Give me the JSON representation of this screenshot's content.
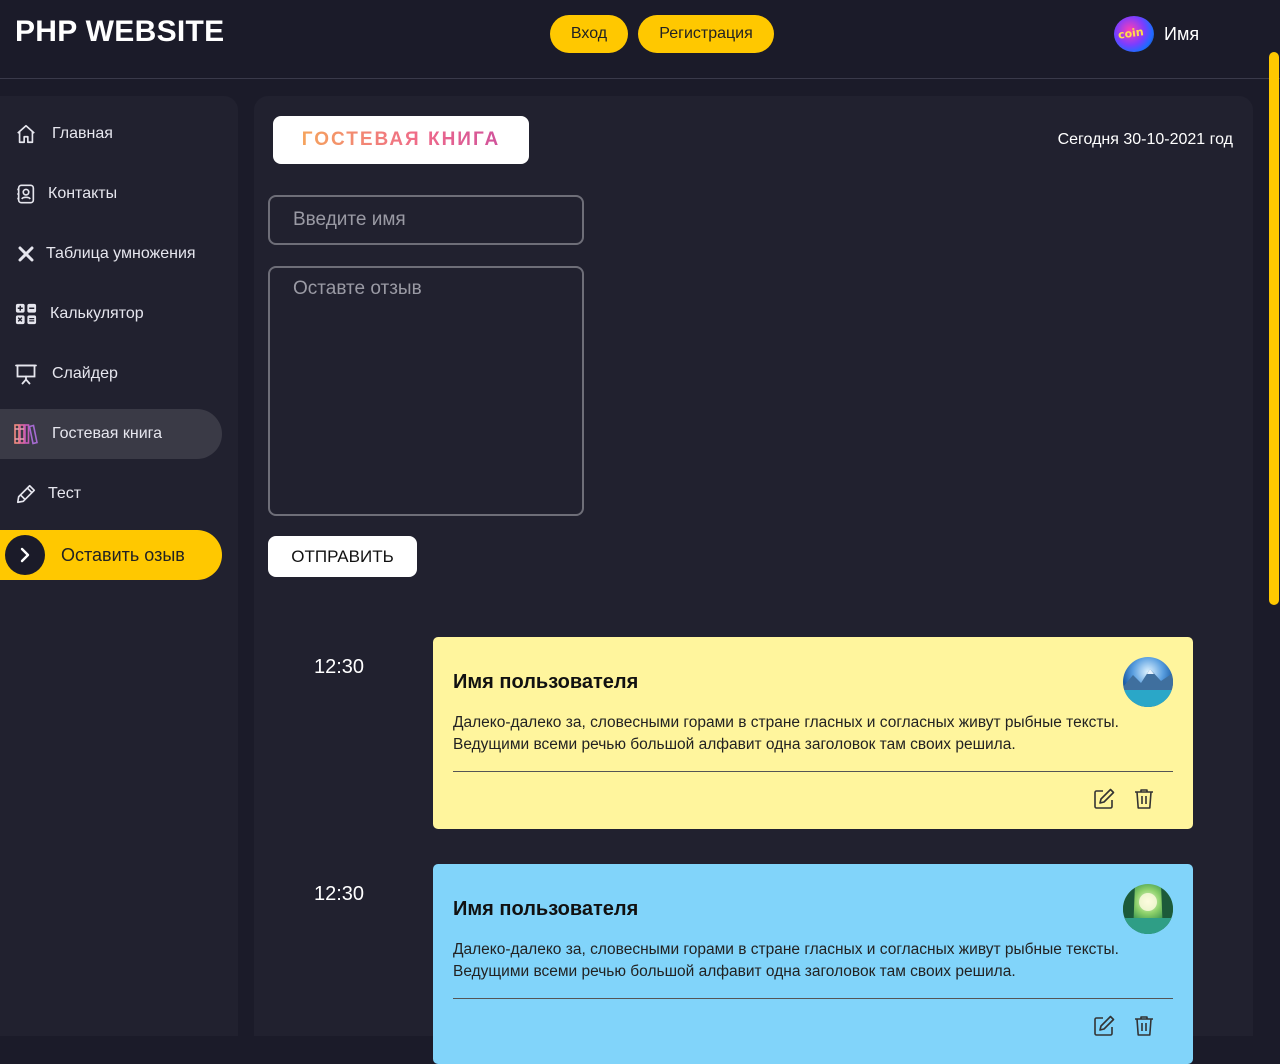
{
  "header": {
    "logo": "PHP WEBSITE",
    "login_label": "Вход",
    "register_label": "Регистрация",
    "user_name": "Имя",
    "avatar_text": "coin"
  },
  "sidebar": {
    "items": [
      {
        "label": "Главная",
        "icon": "home-icon"
      },
      {
        "label": "Контакты",
        "icon": "contacts-icon"
      },
      {
        "label": "Таблица умножения",
        "icon": "multiply-icon"
      },
      {
        "label": "Калькулятор",
        "icon": "calculator-icon"
      },
      {
        "label": "Слайдер",
        "icon": "presentation-icon"
      },
      {
        "label": "Гостевая книга",
        "icon": "books-icon",
        "active": true
      },
      {
        "label": "Тест",
        "icon": "pen-icon"
      }
    ],
    "cta_label": "Оставить озыв"
  },
  "main": {
    "title": "ГОСТЕВАЯ КНИГА",
    "date": "Сегодня 30-10-2021 год",
    "name_placeholder": "Введите имя",
    "review_placeholder": "Оставте отзыв",
    "send_label": "ОТПРАВИТЬ"
  },
  "reviews": [
    {
      "time": "12:30",
      "name": "Имя пользователя",
      "text": "Далеко-далеко за, словесными горами в стране гласных и согласных живут рыбные тексты. Ведущими всеми речью большой алфавит одна заголовок там своих решила.",
      "color": "#fff59d"
    },
    {
      "time": "12:30",
      "name": "Имя пользователя",
      "text": "Далеко-далеко за, словесными горами в стране гласных и согласных живут рыбные тексты. Ведущими всеми речью большой алфавит одна заголовок там своих решила.",
      "color": "#81d4fa"
    }
  ],
  "colors": {
    "accent": "#ffc800",
    "background": "#1b1b29",
    "panel": "#21212f"
  }
}
